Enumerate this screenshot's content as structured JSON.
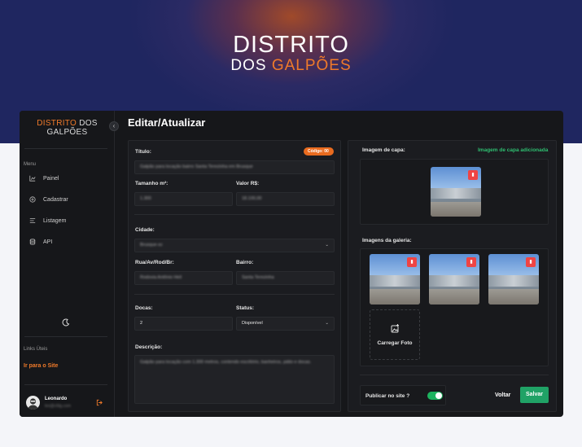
{
  "brand": {
    "line1": "DISTRITO",
    "line2a": "DOS ",
    "line2b": "GALPÕES"
  },
  "sidebar": {
    "logo": {
      "a": "DISTRITO",
      "b": " DOS",
      "c": "GALPÕES"
    },
    "collapse_icon": "chevron-left",
    "menu_title": "Menu",
    "items": [
      {
        "label": "Painel",
        "icon": "chart-icon"
      },
      {
        "label": "Cadastrar",
        "icon": "plus-circle-icon"
      },
      {
        "label": "Listagem",
        "icon": "list-icon"
      },
      {
        "label": "API",
        "icon": "database-icon"
      }
    ],
    "links_title": "Links Úteis",
    "site_link": "Ir para o Site",
    "user": {
      "name": "Leonardo",
      "email": "leo@cfdg.com"
    }
  },
  "page_title": "Editar/Atualizar",
  "form": {
    "codigo_label": "Código: 00",
    "titulo": {
      "label": "Título:",
      "value": "Galpão para locação bairro Santa Terezinha em Brusque"
    },
    "tamanho": {
      "label": "Tamanho m²:",
      "value": "1.300"
    },
    "valor": {
      "label": "Valor R$:",
      "value": "18.100,00"
    },
    "cidade": {
      "label": "Cidade:",
      "value": "Brusque-sc"
    },
    "rua": {
      "label": "Rua/Av/Rod/Br:",
      "value": "Rodovia Antônio Heil"
    },
    "bairro": {
      "label": "Bairro:",
      "value": "Santa Terezinha"
    },
    "docas": {
      "label": "Docas:",
      "value": "2"
    },
    "status": {
      "label": "Status:",
      "value": "Disponível"
    },
    "descricao": {
      "label": "Descrição:",
      "value": "Galpão para locação com 1.300 metros, contendo escritório, banheiros, pátio e docas."
    }
  },
  "media": {
    "cover_label": "Imagem de capa:",
    "cover_status": "Imagem de capa adicionada",
    "gallery_label": "Imagens da galeria:",
    "upload_label": "Carregar Foto"
  },
  "footer": {
    "publish_label": "Publicar no site ?",
    "publish_on": true,
    "back": "Voltar",
    "save": "Salvar"
  },
  "colors": {
    "accent": "#f07a2a",
    "success": "#20a266",
    "danger": "#ef4444"
  }
}
